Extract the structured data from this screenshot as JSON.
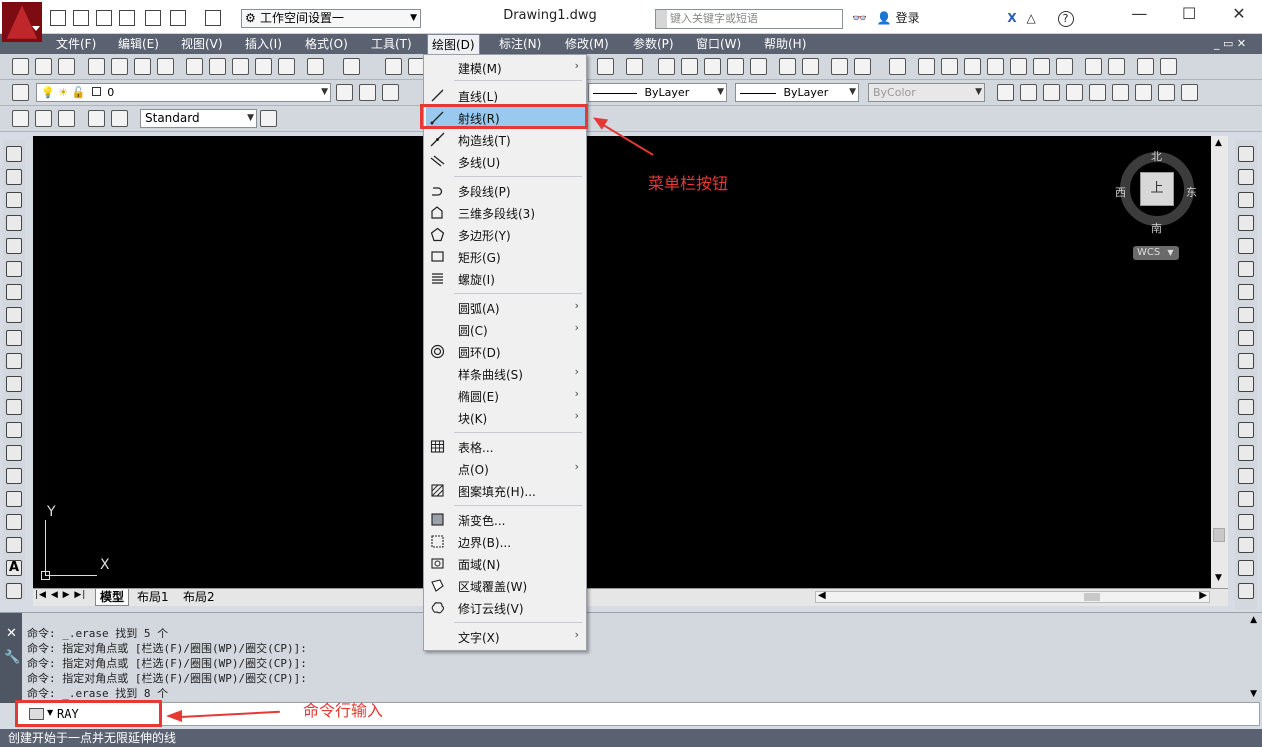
{
  "window": {
    "title": "Drawing1.dwg",
    "workspace": "工作空间设置一",
    "search_placeholder": "键入关键字或短语",
    "login": "登录",
    "help": "?"
  },
  "menubar": [
    "文件(F)",
    "编辑(E)",
    "视图(V)",
    "插入(I)",
    "格式(O)",
    "工具(T)",
    "绘图(D)",
    "标注(N)",
    "修改(M)",
    "参数(P)",
    "窗口(W)",
    "帮助(H)"
  ],
  "toolbar": {
    "layer_combo": "0",
    "style_combo": "Standard",
    "linetype_combo": "ByLayer",
    "lineweight_combo": "ByLayer",
    "plotstyle_combo": "ByColor"
  },
  "draw_menu": {
    "items": [
      {
        "label": "建模(M)",
        "submenu": true
      },
      {
        "label": "直线(L)",
        "submenu": false
      },
      {
        "label": "射线(R)",
        "submenu": false
      },
      {
        "label": "构造线(T)",
        "submenu": false
      },
      {
        "label": "多线(U)",
        "submenu": false
      },
      {
        "label": "多段线(P)",
        "submenu": false
      },
      {
        "label": "三维多段线(3)",
        "submenu": false
      },
      {
        "label": "多边形(Y)",
        "submenu": false
      },
      {
        "label": "矩形(G)",
        "submenu": false
      },
      {
        "label": "螺旋(I)",
        "submenu": false
      },
      {
        "label": "圆弧(A)",
        "submenu": true
      },
      {
        "label": "圆(C)",
        "submenu": true
      },
      {
        "label": "圆环(D)",
        "submenu": false
      },
      {
        "label": "样条曲线(S)",
        "submenu": true
      },
      {
        "label": "椭圆(E)",
        "submenu": true
      },
      {
        "label": "块(K)",
        "submenu": true
      },
      {
        "label": "表格...",
        "submenu": false
      },
      {
        "label": "点(O)",
        "submenu": true
      },
      {
        "label": "图案填充(H)...",
        "submenu": false
      },
      {
        "label": "渐变色...",
        "submenu": false
      },
      {
        "label": "边界(B)...",
        "submenu": false
      },
      {
        "label": "面域(N)",
        "submenu": false
      },
      {
        "label": "区域覆盖(W)",
        "submenu": false
      },
      {
        "label": "修订云线(V)",
        "submenu": false
      },
      {
        "label": "文字(X)",
        "submenu": true
      }
    ],
    "highlighted": "射线(R)"
  },
  "viewcube": {
    "north": "北",
    "south": "南",
    "east": "东",
    "west": "西",
    "face": "上",
    "wcs": "WCS"
  },
  "ucs": {
    "x": "X",
    "y": "Y"
  },
  "layout_tabs": [
    "模型",
    "布局1",
    "布局2"
  ],
  "command": {
    "history": [
      "命令: _.erase 找到 5 个",
      "命令: 指定对角点或 [栏选(F)/圈围(WP)/圈交(CP)]:",
      "命令: 指定对角点或 [栏选(F)/圈围(WP)/圈交(CP)]:",
      "命令: 指定对角点或 [栏选(F)/圈围(WP)/圈交(CP)]:",
      "命令: _.erase 找到 8 个"
    ],
    "input_value": "RAY",
    "status": "创建开始于一点并无限延伸的线"
  },
  "annotations": {
    "menu_label": "菜单栏按钮",
    "cmd_label": "命令行输入",
    "color": "#e53935"
  }
}
